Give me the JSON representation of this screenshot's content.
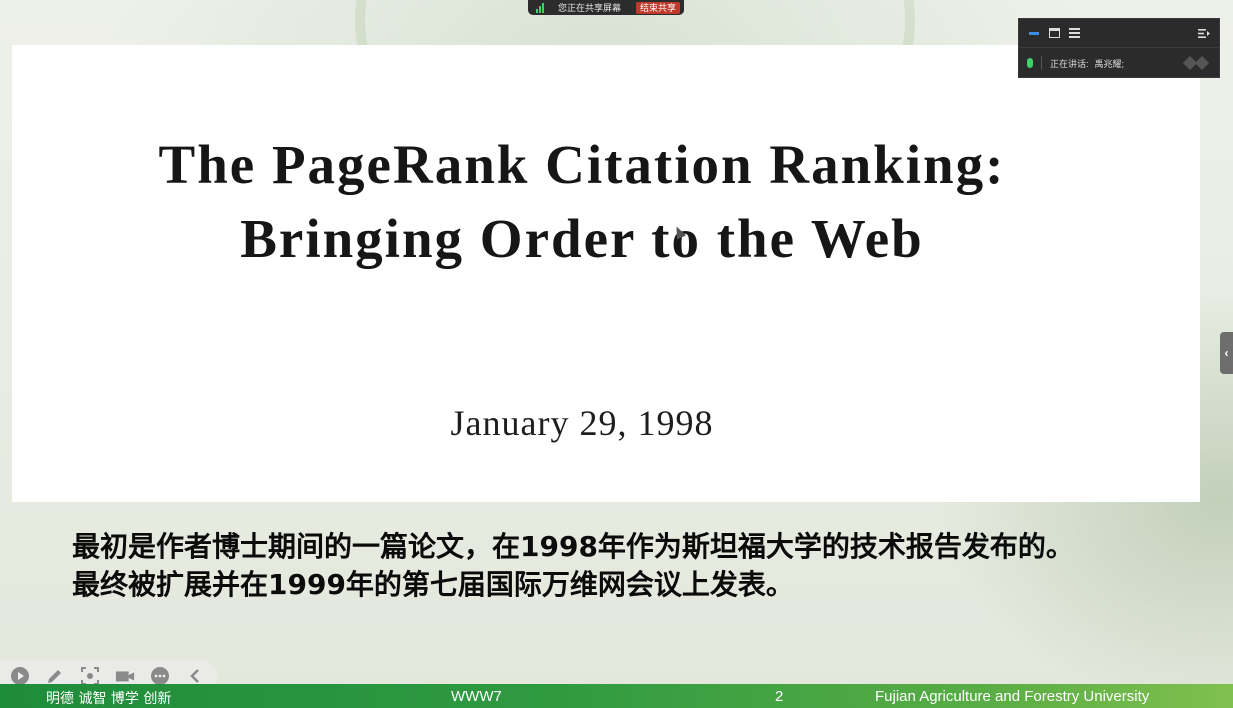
{
  "share_banner": {
    "text": "您正在共享屏幕",
    "end_button": "结束共享"
  },
  "float_panel": {
    "speaking_label": "正在讲话:",
    "speaker_name": "禹兆耀;"
  },
  "slide": {
    "title_line1": "The PageRank Citation Ranking:",
    "title_line2": "Bringing Order to the Web",
    "date": "January 29, 1998",
    "caption_line1": "最初是作者博士期间的一篇论文，在1998年作为斯坦福大学的技术报告发布的。",
    "caption_line2": "最终被扩展并在1999年的第七届国际万维网会议上发表。"
  },
  "footer": {
    "motto": "明德 诚智 博学 创新",
    "course": "WWW7",
    "page": "2",
    "university": "Fujian Agriculture and Forestry University"
  },
  "toolbar": {
    "icons": [
      "play-icon",
      "pen-icon",
      "screenshot-icon",
      "camera-icon",
      "more-icon",
      "chevron-left-icon"
    ]
  },
  "colors": {
    "footer_green": "#2f9a40",
    "end_share_red": "#c0392b",
    "signal_green": "#3fd06a",
    "minimize_blue": "#3a8ee6"
  }
}
